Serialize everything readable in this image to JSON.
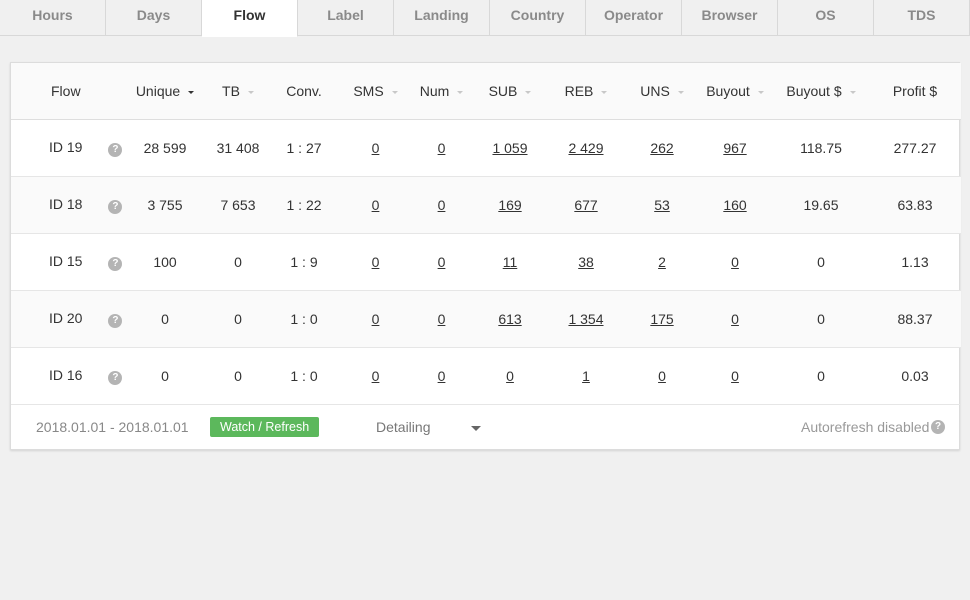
{
  "tabs": [
    {
      "label": "Hours",
      "active": false
    },
    {
      "label": "Days",
      "active": false
    },
    {
      "label": "Flow",
      "active": true
    },
    {
      "label": "Label",
      "active": false
    },
    {
      "label": "Landing",
      "active": false
    },
    {
      "label": "Country",
      "active": false
    },
    {
      "label": "Operator",
      "active": false
    },
    {
      "label": "Browser",
      "active": false
    },
    {
      "label": "OS",
      "active": false
    },
    {
      "label": "TDS",
      "active": false
    }
  ],
  "table": {
    "headers": {
      "flow": "Flow",
      "unique": "Unique",
      "tb": "TB",
      "conv": "Conv.",
      "sms": "SMS",
      "num": "Num",
      "sub": "SUB",
      "reb": "REB",
      "uns": "UNS",
      "buyout": "Buyout",
      "buyout_usd": "Buyout $",
      "profit_usd": "Profit $"
    },
    "rows": [
      {
        "flow": "ID 19",
        "unique": "28 599",
        "tb": "31 408",
        "conv": "1 : 27",
        "sms": "0",
        "num": "0",
        "sub": "1 059",
        "reb": "2 429",
        "uns": "262",
        "buyout": "967",
        "buyout_usd": "118.75",
        "profit_usd": "277.27"
      },
      {
        "flow": "ID 18",
        "unique": "3 755",
        "tb": "7 653",
        "conv": "1 : 22",
        "sms": "0",
        "num": "0",
        "sub": "169",
        "reb": "677",
        "uns": "53",
        "buyout": "160",
        "buyout_usd": "19.65",
        "profit_usd": "63.83"
      },
      {
        "flow": "ID 15",
        "unique": "100",
        "tb": "0",
        "conv": "1 : 9",
        "sms": "0",
        "num": "0",
        "sub": "11",
        "reb": "38",
        "uns": "2",
        "buyout": "0",
        "buyout_usd": "0",
        "profit_usd": "1.13"
      },
      {
        "flow": "ID 20",
        "unique": "0",
        "tb": "0",
        "conv": "1 : 0",
        "sms": "0",
        "num": "0",
        "sub": "613",
        "reb": "1 354",
        "uns": "175",
        "buyout": "0",
        "buyout_usd": "0",
        "profit_usd": "88.37"
      },
      {
        "flow": "ID 16",
        "unique": "0",
        "tb": "0",
        "conv": "1 : 0",
        "sms": "0",
        "num": "0",
        "sub": "0",
        "reb": "1",
        "uns": "0",
        "buyout": "0",
        "buyout_usd": "0",
        "profit_usd": "0.03"
      }
    ]
  },
  "footer": {
    "date_range": "2018.01.01 - 2018.01.01",
    "watch_label": "Watch / Refresh",
    "detailing_label": "Detailing",
    "autorefresh_label": "Autorefresh disabled"
  },
  "icons": {
    "help": "?"
  },
  "colors": {
    "accent_green": "#5cb85c",
    "background": "#f0f0f0"
  }
}
